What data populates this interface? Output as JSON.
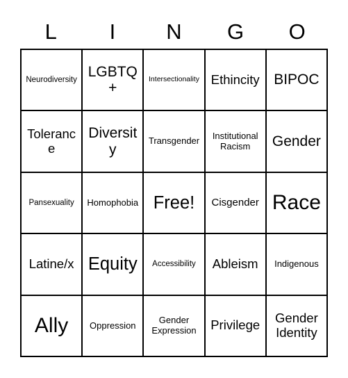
{
  "card": {
    "title": "LINGO Bingo Card",
    "background_color": "#ffffff",
    "border_color": "#000000",
    "text_color": "#000000",
    "columns": 5,
    "rows": 5
  },
  "header": {
    "letters": [
      "L",
      "I",
      "N",
      "G",
      "O"
    ]
  },
  "grid": {
    "free_space_label": "Free!",
    "free_space_position": {
      "row": 3,
      "column": 3
    },
    "cells": [
      [
        {
          "label": "Neurodiversity",
          "size": "fs-xs",
          "free": false
        },
        {
          "label": "LGBTQ+",
          "size": "fs-xl",
          "free": false
        },
        {
          "label": "Intersectionality",
          "size": "fs-xxs",
          "free": false
        },
        {
          "label": "Ethincity",
          "size": "fs-lg",
          "free": false
        },
        {
          "label": "BIPOC",
          "size": "fs-xl",
          "free": false
        }
      ],
      [
        {
          "label": "Tolerance",
          "size": "fs-lg",
          "free": false
        },
        {
          "label": "Diversity",
          "size": "fs-xl",
          "free": false
        },
        {
          "label": "Transgender",
          "size": "fs-sm",
          "free": false
        },
        {
          "label": "Institutional\nRacism",
          "size": "fs-sm",
          "free": false
        },
        {
          "label": "Gender",
          "size": "fs-xl",
          "free": false
        }
      ],
      [
        {
          "label": "Pansexuality",
          "size": "fs-xs",
          "free": false
        },
        {
          "label": "Homophobia",
          "size": "fs-sm",
          "free": false
        },
        {
          "label": "Free!",
          "size": "fs-xxl",
          "free": true
        },
        {
          "label": "Cisgender",
          "size": "fs-md",
          "free": false
        },
        {
          "label": "Race",
          "size": "fs-huge",
          "free": false
        }
      ],
      [
        {
          "label": "Latine/x",
          "size": "fs-lg",
          "free": false
        },
        {
          "label": "Equity",
          "size": "fs-xxl",
          "free": false
        },
        {
          "label": "Accessibility",
          "size": "fs-xs",
          "free": false
        },
        {
          "label": "Ableism",
          "size": "fs-lg",
          "free": false
        },
        {
          "label": "Indigenous",
          "size": "fs-sm",
          "free": false
        }
      ],
      [
        {
          "label": "Ally",
          "size": "fs-huge",
          "free": false
        },
        {
          "label": "Oppression",
          "size": "fs-sm",
          "free": false
        },
        {
          "label": "Gender\nExpression",
          "size": "fs-sm",
          "free": false
        },
        {
          "label": "Privilege",
          "size": "fs-lg",
          "free": false
        },
        {
          "label": "Gender\nIdentity",
          "size": "fs-lg",
          "free": false
        }
      ]
    ]
  }
}
